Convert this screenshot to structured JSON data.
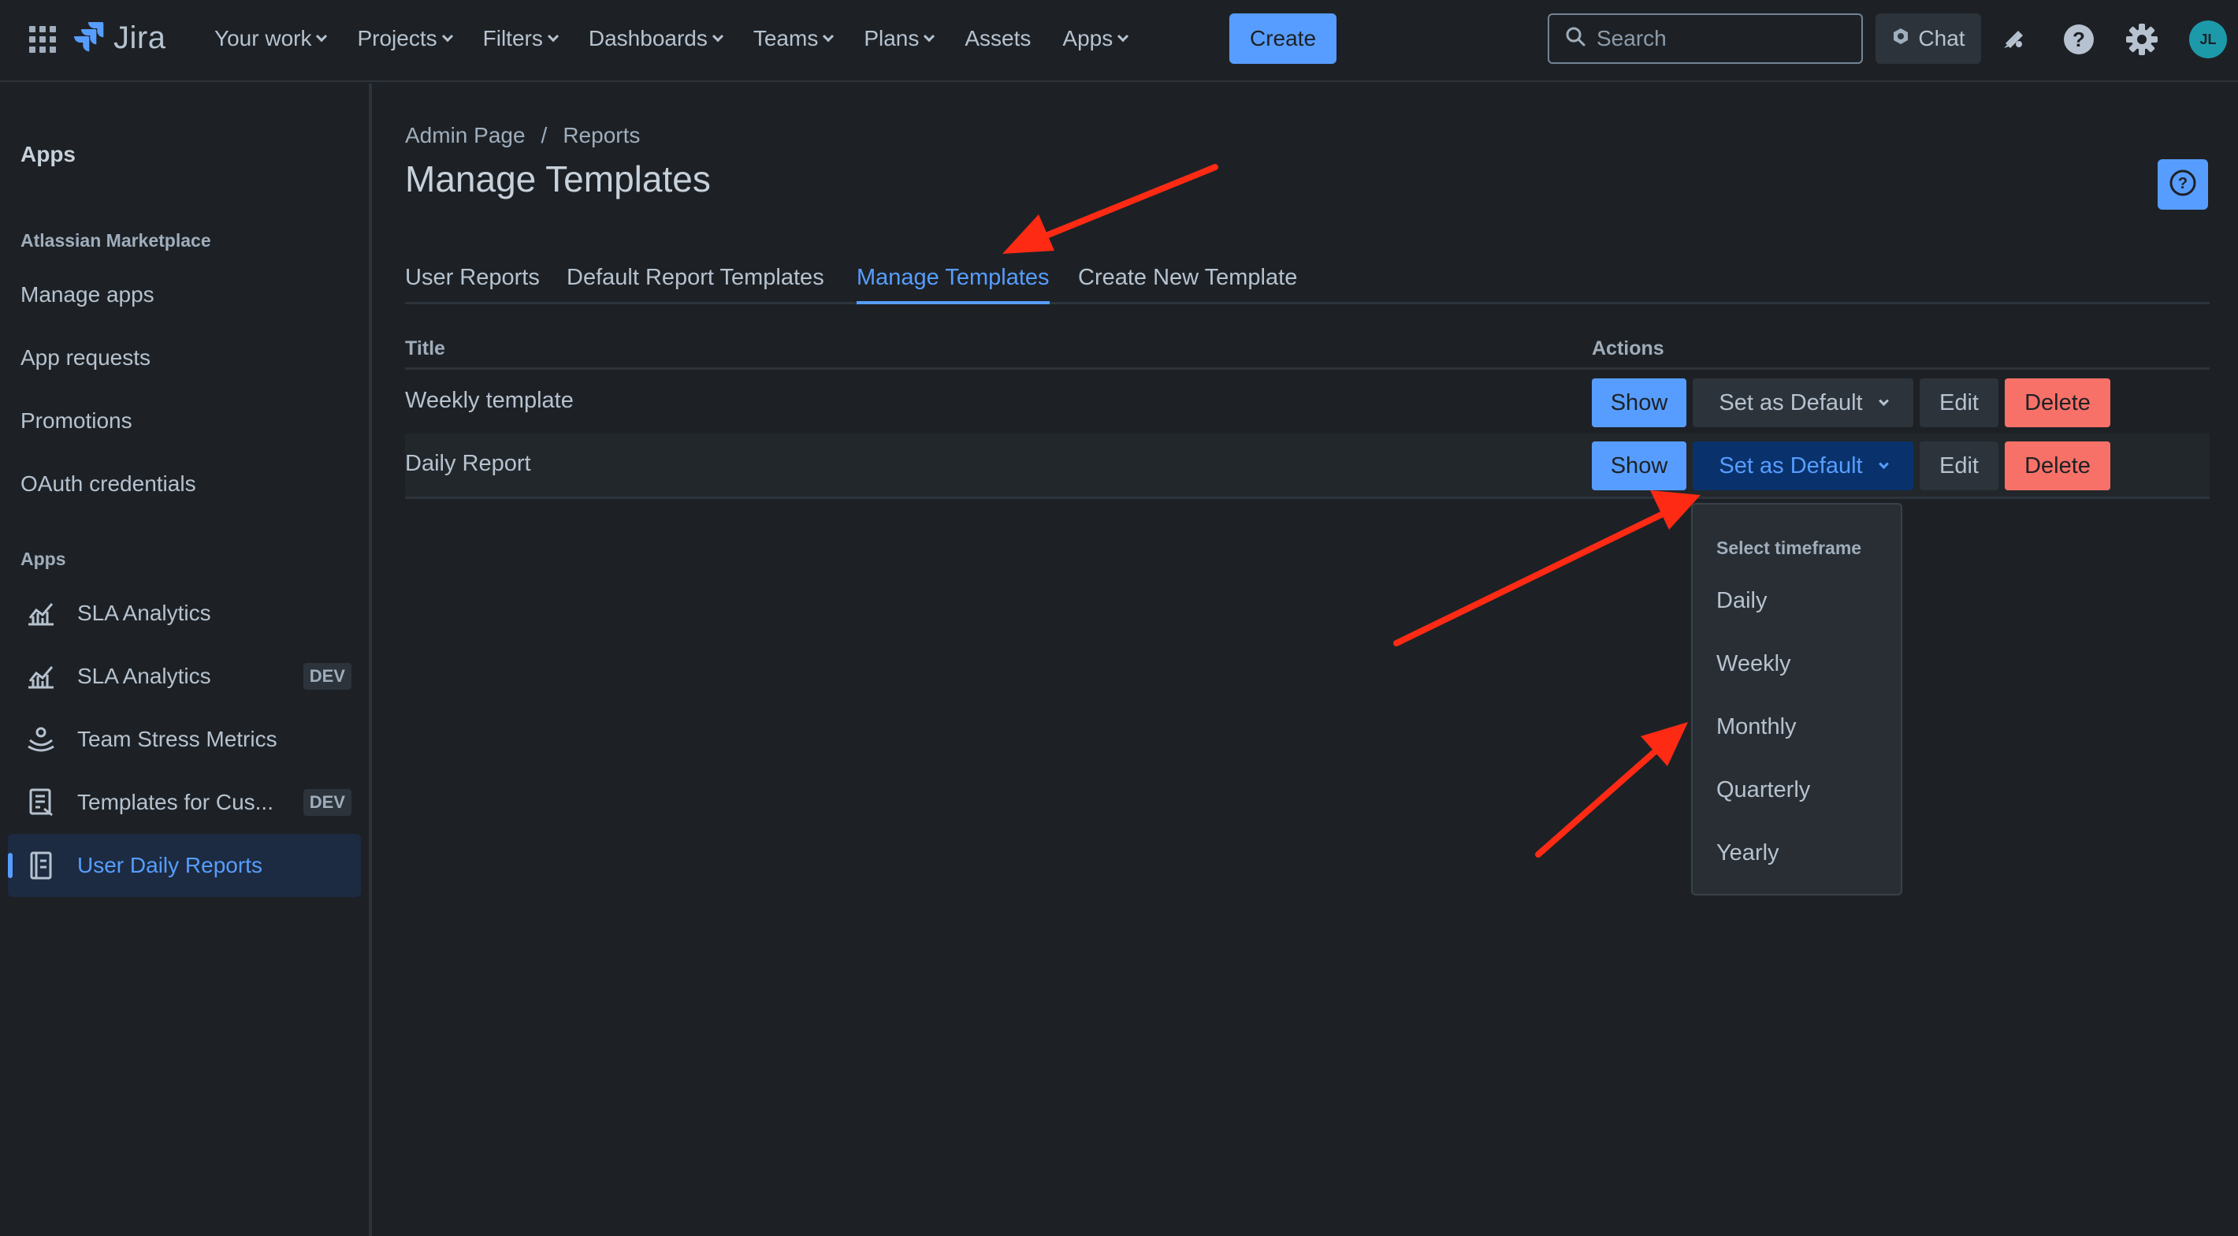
{
  "topbar": {
    "logo_text": "Jira",
    "nav": [
      {
        "label": "Your work",
        "has_menu": true
      },
      {
        "label": "Projects",
        "has_menu": true
      },
      {
        "label": "Filters",
        "has_menu": true
      },
      {
        "label": "Dashboards",
        "has_menu": true
      },
      {
        "label": "Teams",
        "has_menu": true
      },
      {
        "label": "Plans",
        "has_menu": true
      },
      {
        "label": "Assets",
        "has_menu": false
      },
      {
        "label": "Apps",
        "has_menu": true
      }
    ],
    "create_label": "Create",
    "search_placeholder": "Search",
    "chat_label": "Chat",
    "avatar_initials": "JL",
    "icons": [
      "app-switcher-icon",
      "jira-logo-icon",
      "search-icon",
      "chat-icon",
      "notifications-icon",
      "help-icon",
      "settings-icon"
    ]
  },
  "sidebar": {
    "heading": "Apps",
    "marketplace_section": "Atlassian Marketplace",
    "marketplace_links": [
      "Manage apps",
      "App requests",
      "Promotions",
      "OAuth credentials"
    ],
    "apps_section": "Apps",
    "apps": [
      {
        "label": "SLA Analytics",
        "badge": "",
        "icon": "chart-icon",
        "active": false
      },
      {
        "label": "SLA Analytics",
        "badge": "DEV",
        "icon": "chart-icon",
        "active": false
      },
      {
        "label": "Team Stress Metrics",
        "badge": "",
        "icon": "stress-icon",
        "active": false
      },
      {
        "label": "Templates for Cus...",
        "badge": "DEV",
        "icon": "template-icon",
        "active": false
      },
      {
        "label": "User Daily Reports",
        "badge": "",
        "icon": "report-icon",
        "active": true
      }
    ]
  },
  "main": {
    "breadcrumbs": [
      "Admin Page",
      "Reports"
    ],
    "breadcrumb_separator": "/",
    "title": "Manage Templates",
    "tabs": [
      {
        "label": "User Reports",
        "active": false
      },
      {
        "label": "Default Report Templates",
        "active": false
      },
      {
        "label": "Manage Templates",
        "active": true
      },
      {
        "label": "Create New Template",
        "active": false
      }
    ],
    "table": {
      "columns": [
        "Title",
        "Actions"
      ],
      "rows": [
        {
          "title": "Weekly template",
          "show": "Show",
          "set_default": "Set as Default",
          "edit": "Edit",
          "delete": "Delete"
        },
        {
          "title": "Daily Report",
          "show": "Show",
          "set_default": "Set as Default",
          "edit": "Edit",
          "delete": "Delete"
        }
      ]
    },
    "dropdown": {
      "heading": "Select timeframe",
      "options": [
        "Daily",
        "Weekly",
        "Monthly",
        "Quarterly",
        "Yearly"
      ]
    }
  },
  "colors": {
    "background": "#1d2125",
    "accent": "#579dff",
    "danger": "#f87168",
    "annotation_arrow": "#ff2a14"
  }
}
